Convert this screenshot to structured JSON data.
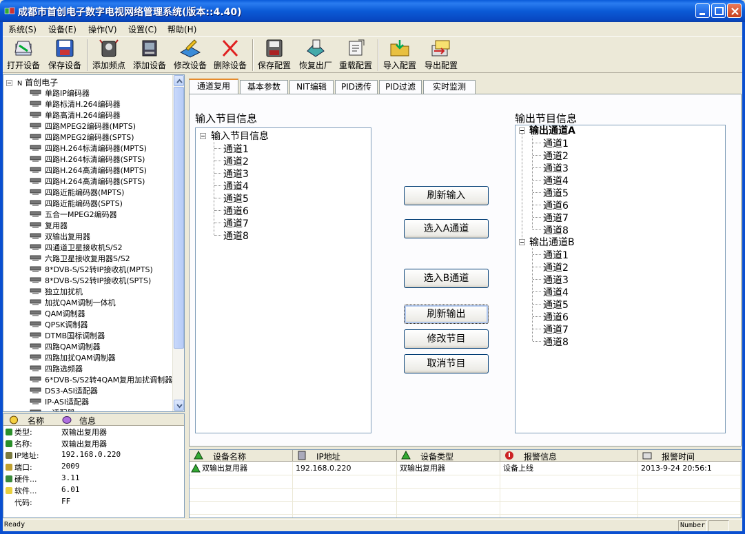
{
  "window": {
    "title": "成都市首创电子数字电视网络管理系统(版本::4.40)"
  },
  "menu": [
    {
      "label": "系统(S)"
    },
    {
      "label": "设备(E)"
    },
    {
      "label": "操作(V)"
    },
    {
      "label": "设置(C)"
    },
    {
      "label": "帮助(H)"
    }
  ],
  "toolbar": [
    {
      "label": "打开设备",
      "icon": "open-device-icon"
    },
    {
      "label": "保存设备",
      "icon": "save-device-icon"
    },
    {
      "label": "添加频点",
      "icon": "add-frequency-icon"
    },
    {
      "label": "添加设备",
      "icon": "add-device-icon"
    },
    {
      "label": "修改设备",
      "icon": "edit-device-icon"
    },
    {
      "label": "删除设备",
      "icon": "delete-device-icon"
    },
    {
      "label": "保存配置",
      "icon": "save-config-icon"
    },
    {
      "label": "恢复出厂",
      "icon": "factory-reset-icon"
    },
    {
      "label": "重载配置",
      "icon": "reload-config-icon"
    },
    {
      "label": "导入配置",
      "icon": "import-config-icon"
    },
    {
      "label": "导出配置",
      "icon": "export-config-icon"
    }
  ],
  "device_tree": {
    "root": "首创电子",
    "items": [
      "单路IP编码器",
      "单路标清H.264编码器",
      "单路高清H.264编码器",
      "四路MPEG2编码器(MPTS)",
      "四路MPEG2编码器(SPTS)",
      "四路H.264标清编码器(MPTS)",
      "四路H.264标清编码器(SPTS)",
      "四路H.264高清编码器(MPTS)",
      "四路H.264高清编码器(SPTS)",
      "四路近能编码器(MPTS)",
      "四路近能编码器(SPTS)",
      "五合一MPEG2编码器",
      "复用器",
      "双输出复用器",
      "四通道卫星接收机S/S2",
      "六路卫星接收复用器S/S2",
      "8*DVB-S/S2转IP接收机(MPTS)",
      "8*DVB-S/S2转IP接收机(SPTS)",
      "独立加扰机",
      "加扰QAM调制一体机",
      "QAM调制器",
      "QPSK调制器",
      "DTMB国标调制器",
      "四路QAM调制器",
      "四路加扰QAM调制器",
      "四路选频器",
      "6*DVB-S/S2转4QAM复用加扰调制器",
      "DS3-ASI适配器",
      "IP-ASI适配器",
      "...适配器"
    ],
    "selected_index": 13
  },
  "info": {
    "col_name": "名称",
    "col_info": "信息",
    "rows": [
      {
        "key": "类型:",
        "value": "双输出复用器"
      },
      {
        "key": "名称:",
        "value": "双输出复用器"
      },
      {
        "key": "IP地址:",
        "value": "192.168.0.220"
      },
      {
        "key": "端口:",
        "value": "2009"
      },
      {
        "key": "硬件...",
        "value": "3.11"
      },
      {
        "key": "软件...",
        "value": "6.01"
      },
      {
        "key": "代码:",
        "value": "FF"
      }
    ]
  },
  "tabs": [
    "通道复用",
    "基本参数",
    "NIT编辑",
    "PID透传",
    "PID过滤",
    "实时监测"
  ],
  "mux": {
    "input_label": "输入节目信息",
    "output_label": "输出节目信息",
    "input_root": "输入节目信息",
    "input_channels": [
      "通道1",
      "通道2",
      "通道3",
      "通道4",
      "通道5",
      "通道6",
      "通道7",
      "通道8"
    ],
    "output_a": "输出通道A",
    "output_b": "输出通道B",
    "output_a_channels": [
      "通道1",
      "通道2",
      "通道3",
      "通道4",
      "通道5",
      "通道6",
      "通道7",
      "通道8"
    ],
    "output_b_channels": [
      "通道1",
      "通道2",
      "通道3",
      "通道4",
      "通道5",
      "通道6",
      "通道7",
      "通道8"
    ],
    "buttons": {
      "refresh_input": "刷新输入",
      "select_a": "选入A通道",
      "select_b": "选入B通道",
      "refresh_output": "刷新输出",
      "edit_program": "修改节目",
      "cancel_program": "取消节目"
    }
  },
  "alarm_list": {
    "headers": [
      "设备名称",
      "IP地址",
      "设备类型",
      "报警信息",
      "报警时间"
    ],
    "rows": [
      [
        "双输出复用器",
        "192.168.0.220",
        "双输出复用器",
        "设备上线",
        "2013-9-24 20:56:1"
      ]
    ]
  },
  "status": {
    "text": "Ready",
    "number": "Number"
  }
}
